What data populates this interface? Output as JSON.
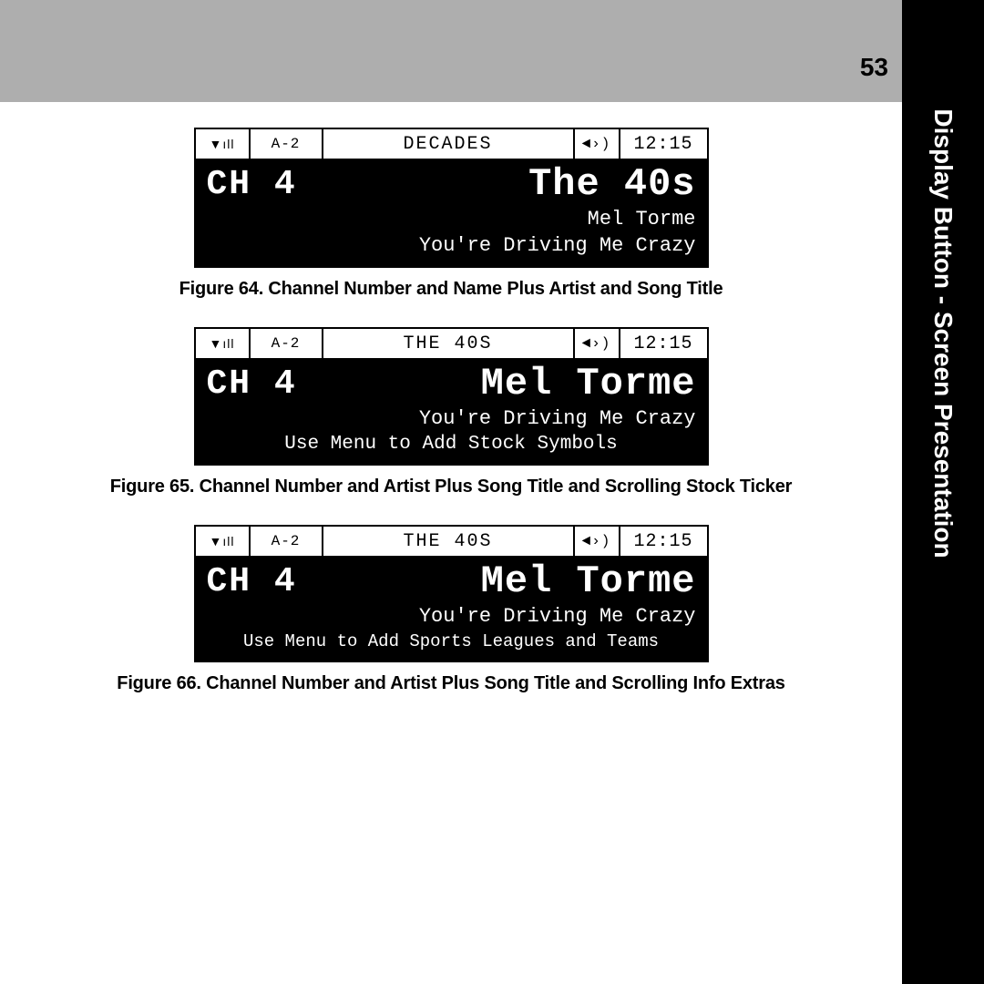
{
  "page_number": "53",
  "side_tab": "Display Button - Screen Presentation",
  "figures": [
    {
      "status": {
        "preset": "A-2",
        "category": "DECADES",
        "time": "12:15"
      },
      "channel": "CH  4",
      "main": "The 40s",
      "line1": "Mel Torme",
      "line2": "You're Driving Me Crazy",
      "caption": "Figure 64. Channel Number and Name Plus Artist and Song Title"
    },
    {
      "status": {
        "preset": "A-2",
        "category": "THE 40S",
        "time": "12:15"
      },
      "channel": "CH  4",
      "main": "Mel Torme",
      "line1": "You're Driving Me Crazy",
      "line2": "Use Menu to Add Stock Symbols",
      "caption": "Figure 65. Channel Number and Artist Plus Song Title and Scrolling Stock Ticker"
    },
    {
      "status": {
        "preset": "A-2",
        "category": "THE 40S",
        "time": "12:15"
      },
      "channel": "CH  4",
      "main": "Mel Torme",
      "line1": "You're Driving Me Crazy",
      "line2": "Use Menu to Add Sports Leagues and Teams",
      "caption": "Figure 66. Channel Number and Artist Plus Song Title and Scrolling Info Extras"
    }
  ]
}
